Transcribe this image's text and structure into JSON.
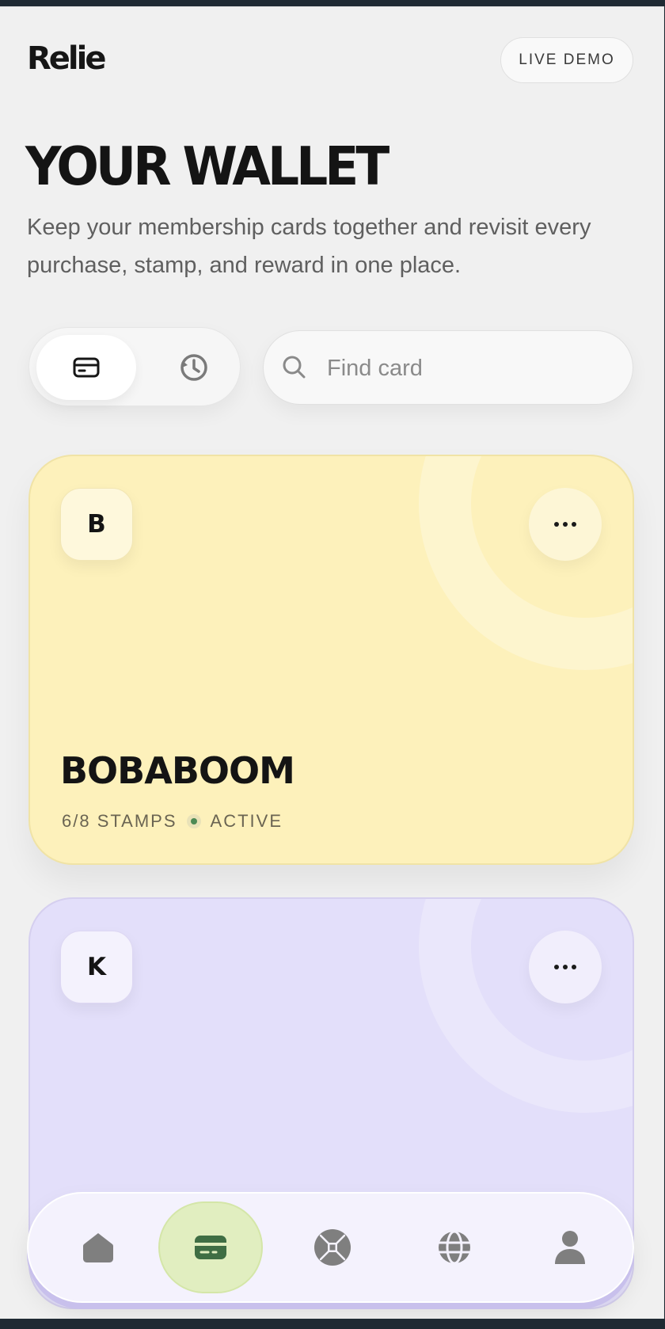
{
  "app": {
    "logo": "Relie",
    "live_demo_label": "LIVE DEMO"
  },
  "header": {
    "title": "YOUR WALLET",
    "subtitle": "Keep your membership cards together and revisit every purchase, stamp, and reward in one place."
  },
  "view_toggle": {
    "options": [
      {
        "icon": "card-icon",
        "selected": true
      },
      {
        "icon": "history-icon",
        "selected": false
      }
    ]
  },
  "search": {
    "placeholder": "Find card",
    "value": "",
    "icon": "search-icon"
  },
  "cards": [
    {
      "initial": "B",
      "name": "BOBABOOM",
      "stamps": "6/8 STAMPS",
      "status": "ACTIVE",
      "color": "#fdf1bb",
      "status_color": "#4d8a55"
    },
    {
      "initial": "K",
      "color": "#e3dffa"
    }
  ],
  "bottom_nav": {
    "items": [
      {
        "icon": "home-icon",
        "active": false
      },
      {
        "icon": "wallet-card-icon",
        "active": true
      },
      {
        "icon": "compass-icon",
        "active": false
      },
      {
        "icon": "globe-icon",
        "active": false
      },
      {
        "icon": "profile-icon",
        "active": false
      }
    ],
    "active_color": "#e1eec0",
    "active_icon_color": "#3f6e44",
    "icon_color": "#7f7f7f"
  }
}
